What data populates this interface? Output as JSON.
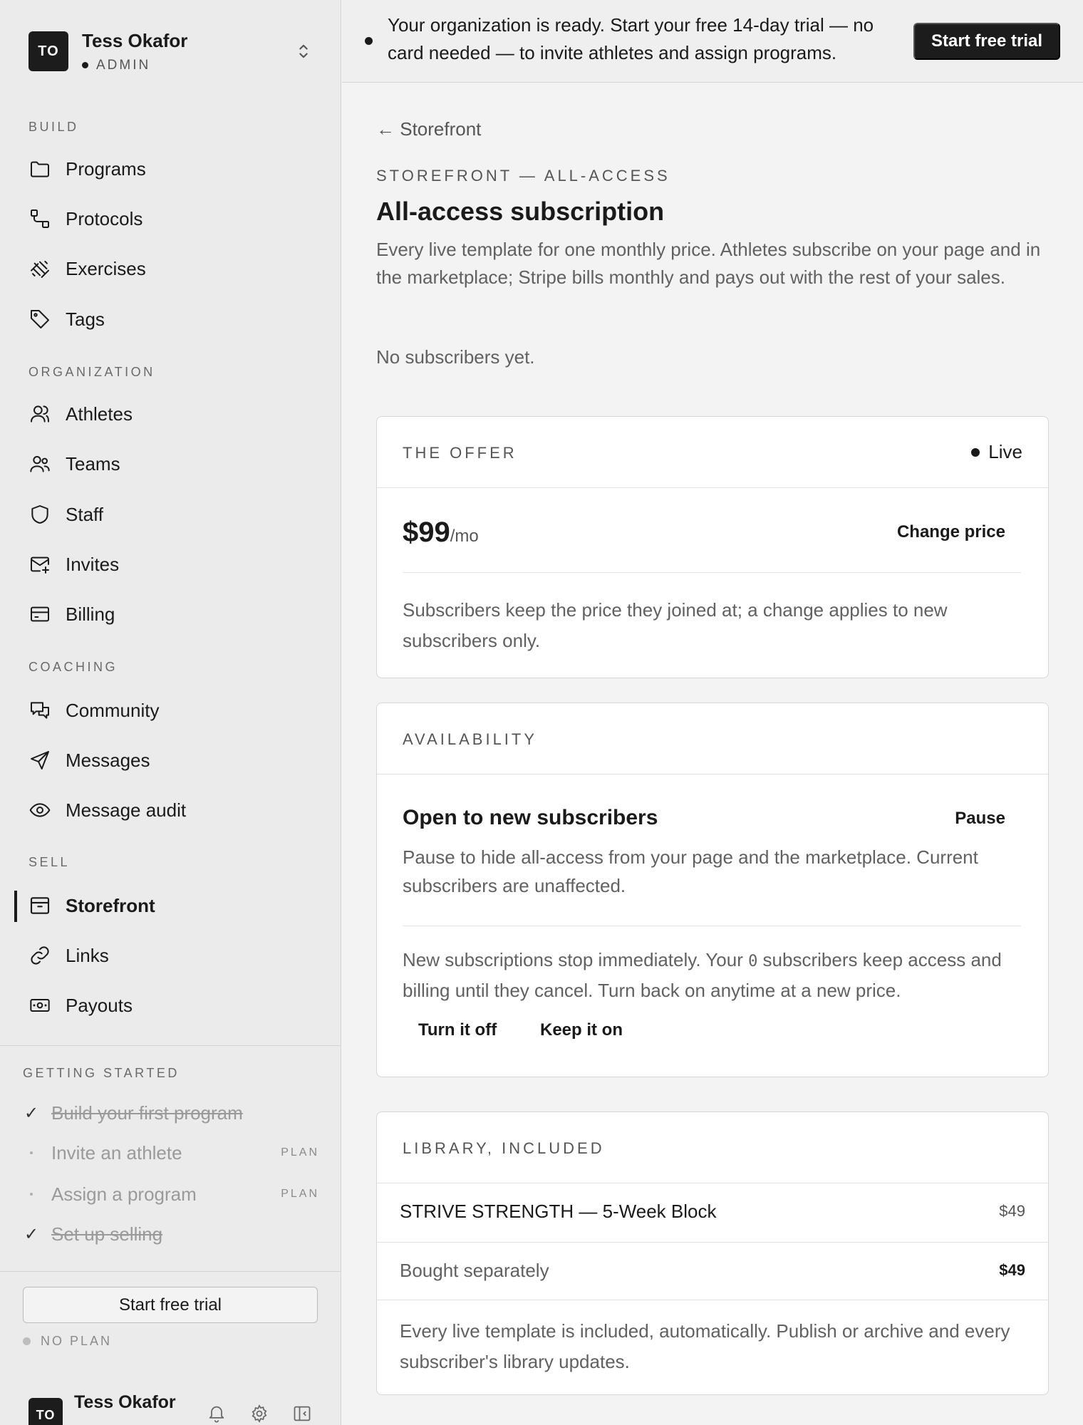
{
  "org": {
    "initials": "TO",
    "name": "Tess Okafor",
    "role": "ADMIN"
  },
  "nav": {
    "build_label": "BUILD",
    "build": [
      {
        "label": "Programs",
        "icon": "folder-icon"
      },
      {
        "label": "Protocols",
        "icon": "protocol-icon"
      },
      {
        "label": "Exercises",
        "icon": "dumbbell-icon"
      },
      {
        "label": "Tags",
        "icon": "tag-icon"
      }
    ],
    "organization_label": "ORGANIZATION",
    "organization": [
      {
        "label": "Athletes",
        "icon": "user-icon"
      },
      {
        "label": "Teams",
        "icon": "users-icon"
      },
      {
        "label": "Staff",
        "icon": "shield-icon"
      },
      {
        "label": "Invites",
        "icon": "mail-plus-icon"
      },
      {
        "label": "Billing",
        "icon": "credit-card-icon"
      }
    ],
    "coaching_label": "COACHING",
    "coaching": [
      {
        "label": "Community",
        "icon": "chat-icon"
      },
      {
        "label": "Messages",
        "icon": "send-icon"
      },
      {
        "label": "Message audit",
        "icon": "eye-icon"
      }
    ],
    "sell_label": "SELL",
    "sell": [
      {
        "label": "Storefront",
        "icon": "storefront-icon",
        "active": true
      },
      {
        "label": "Links",
        "icon": "link-icon"
      },
      {
        "label": "Payouts",
        "icon": "banknote-icon"
      }
    ]
  },
  "getting_started": {
    "label": "GETTING STARTED",
    "items": [
      {
        "label": "Build your first program",
        "done": true,
        "badge": ""
      },
      {
        "label": "Invite an athlete",
        "done": false,
        "badge": "PLAN"
      },
      {
        "label": "Assign a program",
        "done": false,
        "badge": "PLAN"
      },
      {
        "label": "Set up selling",
        "done": true,
        "badge": ""
      }
    ]
  },
  "sidebar_footer": {
    "trial_button": "Start free trial",
    "plan_status": "NO PLAN",
    "user_initials": "TO",
    "user_name": "Tess Okafor"
  },
  "banner": {
    "text": "Your organization is ready. Start your free 14-day trial — no card needed — to invite athletes and assign programs.",
    "button": "Start free trial"
  },
  "page": {
    "back_link": "← Storefront",
    "eyebrow": "STOREFRONT — ALL-ACCESS",
    "title": "All-access subscription",
    "description": "Every live template for one monthly price. Athletes subscribe on your page and in the marketplace; Stripe bills monthly and pays out with the rest of your sales.",
    "subscriber_status": "No subscribers yet."
  },
  "offer": {
    "label": "THE OFFER",
    "status": "Live",
    "price": "$99",
    "price_unit": "/mo",
    "change_button": "Change price",
    "note": "Subscribers keep the price they joined at; a change applies to new subscribers only."
  },
  "availability": {
    "label": "AVAILABILITY",
    "title": "Open to new subscribers",
    "pause_button": "Pause",
    "note": "Pause to hide all-access from your page and the marketplace. Current subscribers are unaffected.",
    "confirm_prefix": "New subscriptions stop immediately. Your ",
    "confirm_count": "0",
    "confirm_suffix": " subscribers keep access and billing until they cancel. Turn back on anytime at a new price.",
    "turn_off": "Turn it off",
    "keep_on": "Keep it on"
  },
  "library": {
    "label": "LIBRARY, INCLUDED",
    "items": [
      {
        "name": "STRIVE STRENGTH — 5-Week Block",
        "price": "$49"
      }
    ],
    "total_label": "Bought separately",
    "total_value": "$49",
    "note": "Every live template is included, automatically. Publish or archive and every subscriber's library updates."
  }
}
